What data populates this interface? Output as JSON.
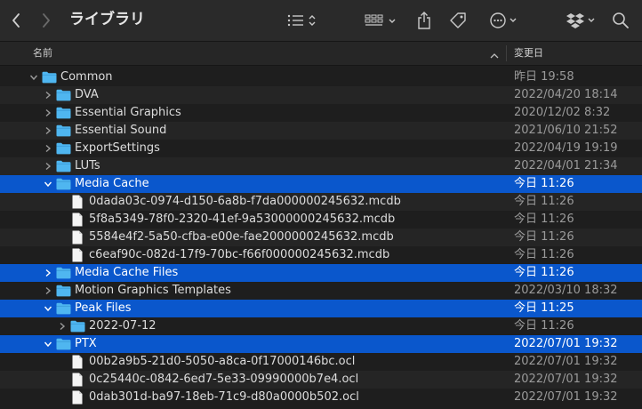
{
  "window": {
    "title": "ライブラリ"
  },
  "toolbar": {
    "back_icon": "chevron-left-icon",
    "forward_icon": "chevron-right-icon",
    "view_icon": "list-view-icon",
    "group_icon": "grid-group-icon",
    "share_icon": "share-icon",
    "tag_icon": "tag-icon",
    "action_icon": "ellipsis-circle-icon",
    "dropbox_icon": "dropbox-icon",
    "search_icon": "search-icon"
  },
  "columns": {
    "name": "名前",
    "date": "変更日"
  },
  "colors": {
    "selection": "#0a57cc",
    "folder": "#4fb6f0",
    "background": "#1e1e1e"
  },
  "rows": [
    {
      "name": "Common",
      "date": "昨日 19:58",
      "type": "folder",
      "expanded": true,
      "depth": 0,
      "selected": false
    },
    {
      "name": "DVA",
      "date": "2022/04/20 18:14",
      "type": "folder",
      "expanded": false,
      "depth": 1,
      "selected": false
    },
    {
      "name": "Essential Graphics",
      "date": "2020/12/02 8:32",
      "type": "folder",
      "expanded": false,
      "depth": 1,
      "selected": false
    },
    {
      "name": "Essential Sound",
      "date": "2021/06/10 21:52",
      "type": "folder",
      "expanded": false,
      "depth": 1,
      "selected": false
    },
    {
      "name": "ExportSettings",
      "date": "2022/04/19 19:19",
      "type": "folder",
      "expanded": false,
      "depth": 1,
      "selected": false
    },
    {
      "name": "LUTs",
      "date": "2022/04/01 21:34",
      "type": "folder",
      "expanded": false,
      "depth": 1,
      "selected": false
    },
    {
      "name": "Media Cache",
      "date": "今日 11:26",
      "type": "folder",
      "expanded": true,
      "depth": 1,
      "selected": true
    },
    {
      "name": "0dada03c-0974-d150-6a8b-f7da000000245632.mcdb",
      "date": "今日 11:26",
      "type": "file",
      "depth": 2,
      "selected": false
    },
    {
      "name": "5f8a5349-78f0-2320-41ef-9a53000000245632.mcdb",
      "date": "今日 11:26",
      "type": "file",
      "depth": 2,
      "selected": false
    },
    {
      "name": "5584e4f2-5a50-cfba-e00e-fae2000000245632.mcdb",
      "date": "今日 11:26",
      "type": "file",
      "depth": 2,
      "selected": false
    },
    {
      "name": "c6eaf90c-082d-17f9-70bc-f66f000000245632.mcdb",
      "date": "今日 11:26",
      "type": "file",
      "depth": 2,
      "selected": false
    },
    {
      "name": "Media Cache Files",
      "date": "今日 11:26",
      "type": "folder",
      "expanded": false,
      "depth": 1,
      "selected": true
    },
    {
      "name": "Motion Graphics Templates",
      "date": "2022/03/10 18:32",
      "type": "folder",
      "expanded": false,
      "depth": 1,
      "selected": false
    },
    {
      "name": "Peak Files",
      "date": "今日 11:25",
      "type": "folder",
      "expanded": true,
      "depth": 1,
      "selected": true
    },
    {
      "name": "2022-07-12",
      "date": "今日 11:26",
      "type": "folder",
      "expanded": false,
      "depth": 2,
      "selected": false
    },
    {
      "name": "PTX",
      "date": "2022/07/01 19:32",
      "type": "folder",
      "expanded": true,
      "depth": 1,
      "selected": true
    },
    {
      "name": "00b2a9b5-21d0-5050-a8ca-0f17000146bc.ocl",
      "date": "2022/07/01 19:32",
      "type": "file",
      "depth": 2,
      "selected": false
    },
    {
      "name": "0c25440c-0842-6ed7-5e33-09990000b7e4.ocl",
      "date": "2022/07/01 19:32",
      "type": "file",
      "depth": 2,
      "selected": false
    },
    {
      "name": "0dab301d-ba97-18eb-71c9-d80a0000b502.ocl",
      "date": "2022/07/01 19:32",
      "type": "file",
      "depth": 2,
      "selected": false
    }
  ]
}
